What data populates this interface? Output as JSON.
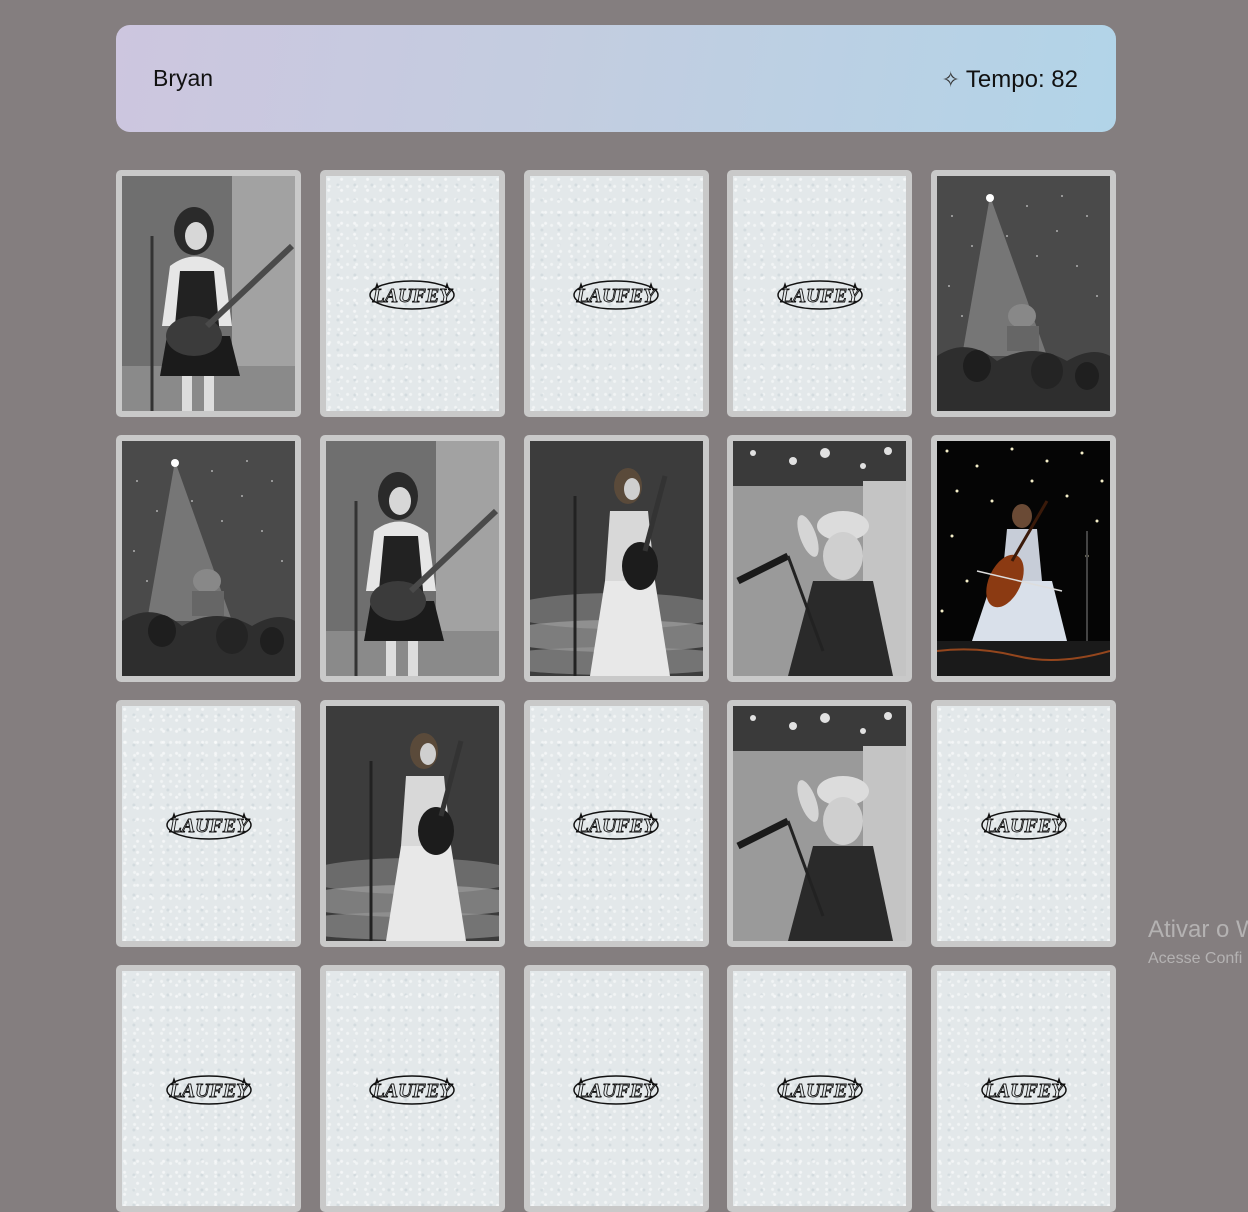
{
  "header": {
    "player_name": "Bryan",
    "timer_icon": "sparkle-icon",
    "timer_text": "Tempo: 82"
  },
  "card_back_logo": "LAUFEY",
  "cards": [
    {
      "state": "face",
      "image": "guitarist-black-vest",
      "tone": "gray"
    },
    {
      "state": "back"
    },
    {
      "state": "back"
    },
    {
      "state": "back"
    },
    {
      "state": "face",
      "image": "spotlight-stage",
      "tone": "gray"
    },
    {
      "state": "face",
      "image": "spotlight-stage",
      "tone": "gray"
    },
    {
      "state": "face",
      "image": "guitarist-black-vest",
      "tone": "gray"
    },
    {
      "state": "face",
      "image": "guitar-white-dress",
      "tone": "gray"
    },
    {
      "state": "face",
      "image": "beret-microphone",
      "tone": "gray"
    },
    {
      "state": "face",
      "image": "cellist-stage",
      "tone": "color"
    },
    {
      "state": "back"
    },
    {
      "state": "face",
      "image": "guitar-white-dress",
      "tone": "gray"
    },
    {
      "state": "back"
    },
    {
      "state": "face",
      "image": "beret-microphone",
      "tone": "gray"
    },
    {
      "state": "back"
    },
    {
      "state": "back"
    },
    {
      "state": "back"
    },
    {
      "state": "back"
    },
    {
      "state": "back"
    },
    {
      "state": "back"
    }
  ],
  "watermark": {
    "line1": "Ativar o W",
    "line2": "Acesse Confi"
  }
}
